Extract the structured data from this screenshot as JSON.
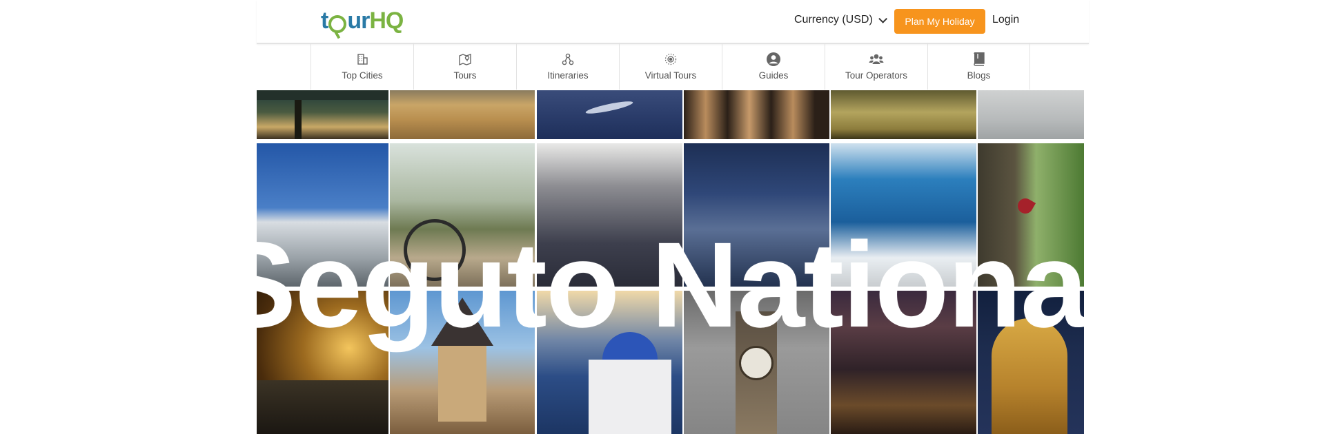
{
  "header": {
    "logo_text": "tourHQ",
    "currency_label": "Currency (USD)",
    "plan_button": "Plan My Holiday",
    "login_label": "Login",
    "accent_color": "#f7941d"
  },
  "nav": {
    "items": [
      {
        "label": "Top Cities",
        "icon": "building-icon"
      },
      {
        "label": "Tours",
        "icon": "map-pin-icon"
      },
      {
        "label": "Itineraries",
        "icon": "route-nodes-icon"
      },
      {
        "label": "Virtual Tours",
        "icon": "virtual-tour-icon"
      },
      {
        "label": "Guides",
        "icon": "user-circle-icon"
      },
      {
        "label": "Tour Operators",
        "icon": "users-group-icon"
      },
      {
        "label": "Blogs",
        "icon": "book-icon"
      }
    ]
  },
  "hero": {
    "headline": "Seguto National Pa"
  }
}
